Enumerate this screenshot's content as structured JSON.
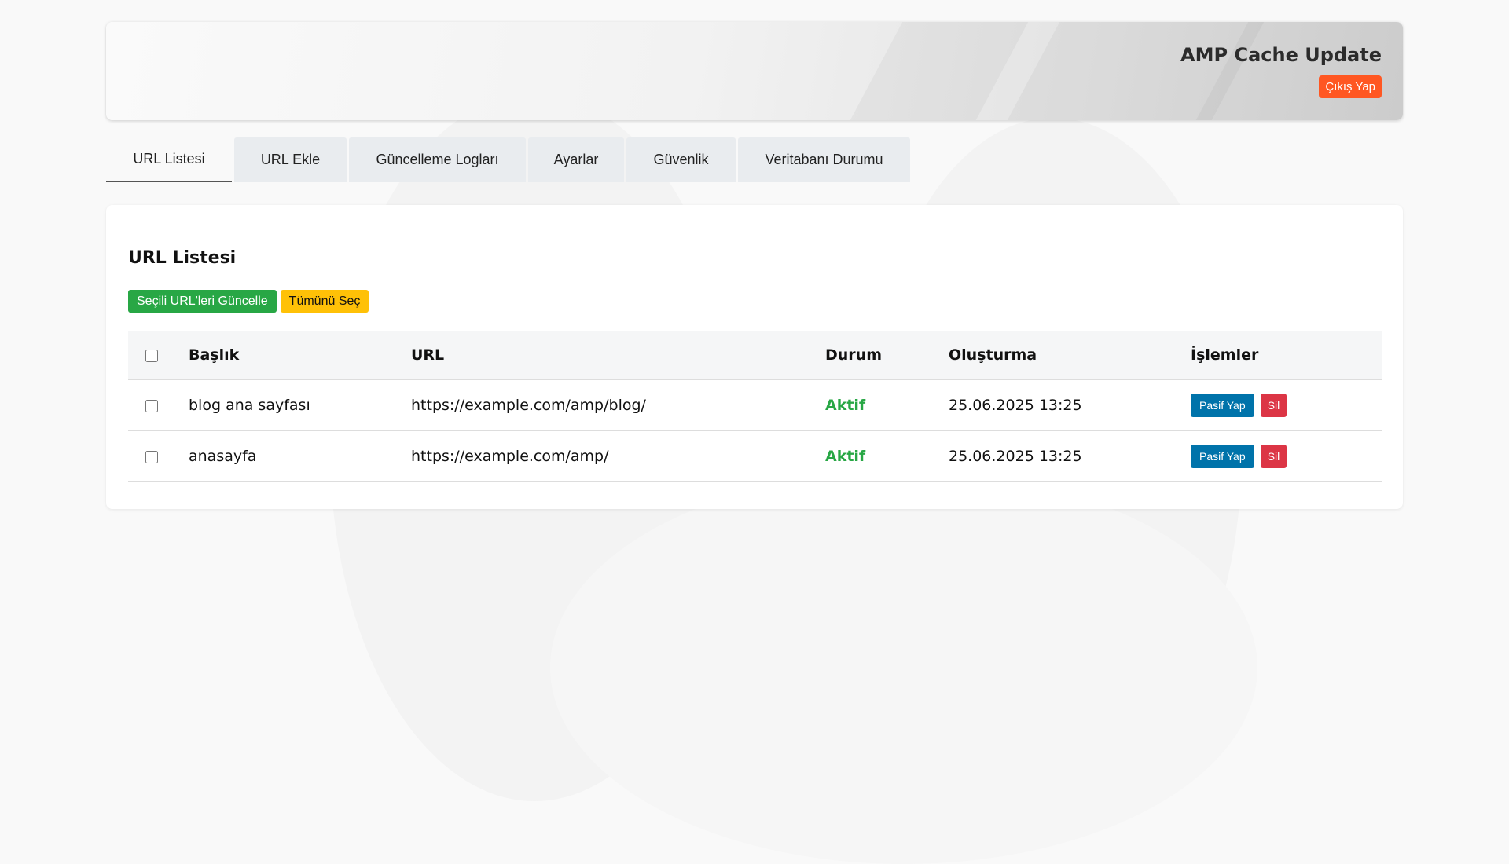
{
  "header": {
    "title": "AMP Cache Update",
    "logout_label": "Çıkış Yap"
  },
  "tabs": [
    {
      "label": "URL Listesi",
      "active": true
    },
    {
      "label": "URL Ekle"
    },
    {
      "label": "Güncelleme Logları"
    },
    {
      "label": "Ayarlar"
    },
    {
      "label": "Güvenlik"
    },
    {
      "label": "Veritabanı Durumu"
    }
  ],
  "panel": {
    "title": "URL Listesi",
    "update_selected_label": "Seçili URL'leri Güncelle",
    "select_all_label": "Tümünü Seç"
  },
  "table": {
    "headers": {
      "title": "Başlık",
      "url": "URL",
      "status": "Durum",
      "created": "Oluşturma",
      "actions": "İşlemler"
    },
    "rows": [
      {
        "title": "blog ana sayfası",
        "url": "https://example.com/amp/blog/",
        "status": "Aktif",
        "created": "25.06.2025 13:25",
        "deactivate_label": "Pasif Yap",
        "delete_label": "Sil"
      },
      {
        "title": "anasayfa",
        "url": "https://example.com/amp/",
        "status": "Aktif",
        "created": "25.06.2025 13:25",
        "deactivate_label": "Pasif Yap",
        "delete_label": "Sil"
      }
    ]
  },
  "colors": {
    "logout": "#ff5722",
    "update_selected": "#28a745",
    "select_all": "#ffc107",
    "deactivate": "#0073aa",
    "delete": "#dc3545",
    "status_active": "#28a745"
  }
}
